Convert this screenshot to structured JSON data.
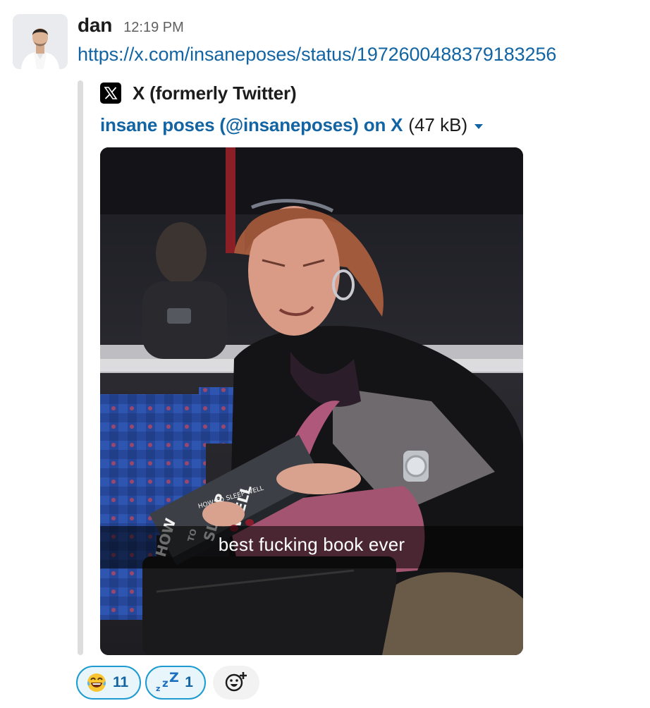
{
  "message": {
    "sender": "dan",
    "timestamp": "12:19 PM",
    "link": "https://x.com/insaneposes/status/1972600488379183256"
  },
  "unfurl": {
    "service_icon": "x-logo-icon",
    "service_name": "X (formerly Twitter)",
    "title": "insane poses (@insaneposes) on X",
    "file_size": "(47 kB)",
    "image": {
      "caption": "best fucking book ever",
      "book_title_lines": [
        "HOW",
        "TO",
        "SLEEP",
        "WELL"
      ],
      "book_spine": "HOW TO SLEEP WELL"
    }
  },
  "reactions": [
    {
      "emoji": "joy-emoji-icon",
      "count": "11"
    },
    {
      "emoji": "zzz-emoji-icon",
      "count": "1"
    }
  ],
  "add_reaction_icon": "add-reaction-icon",
  "colors": {
    "link": "#1264a3",
    "reaction_border": "#1d9bd1",
    "reaction_bg": "#e8f5fa",
    "unfurl_bar": "#dddddd"
  }
}
